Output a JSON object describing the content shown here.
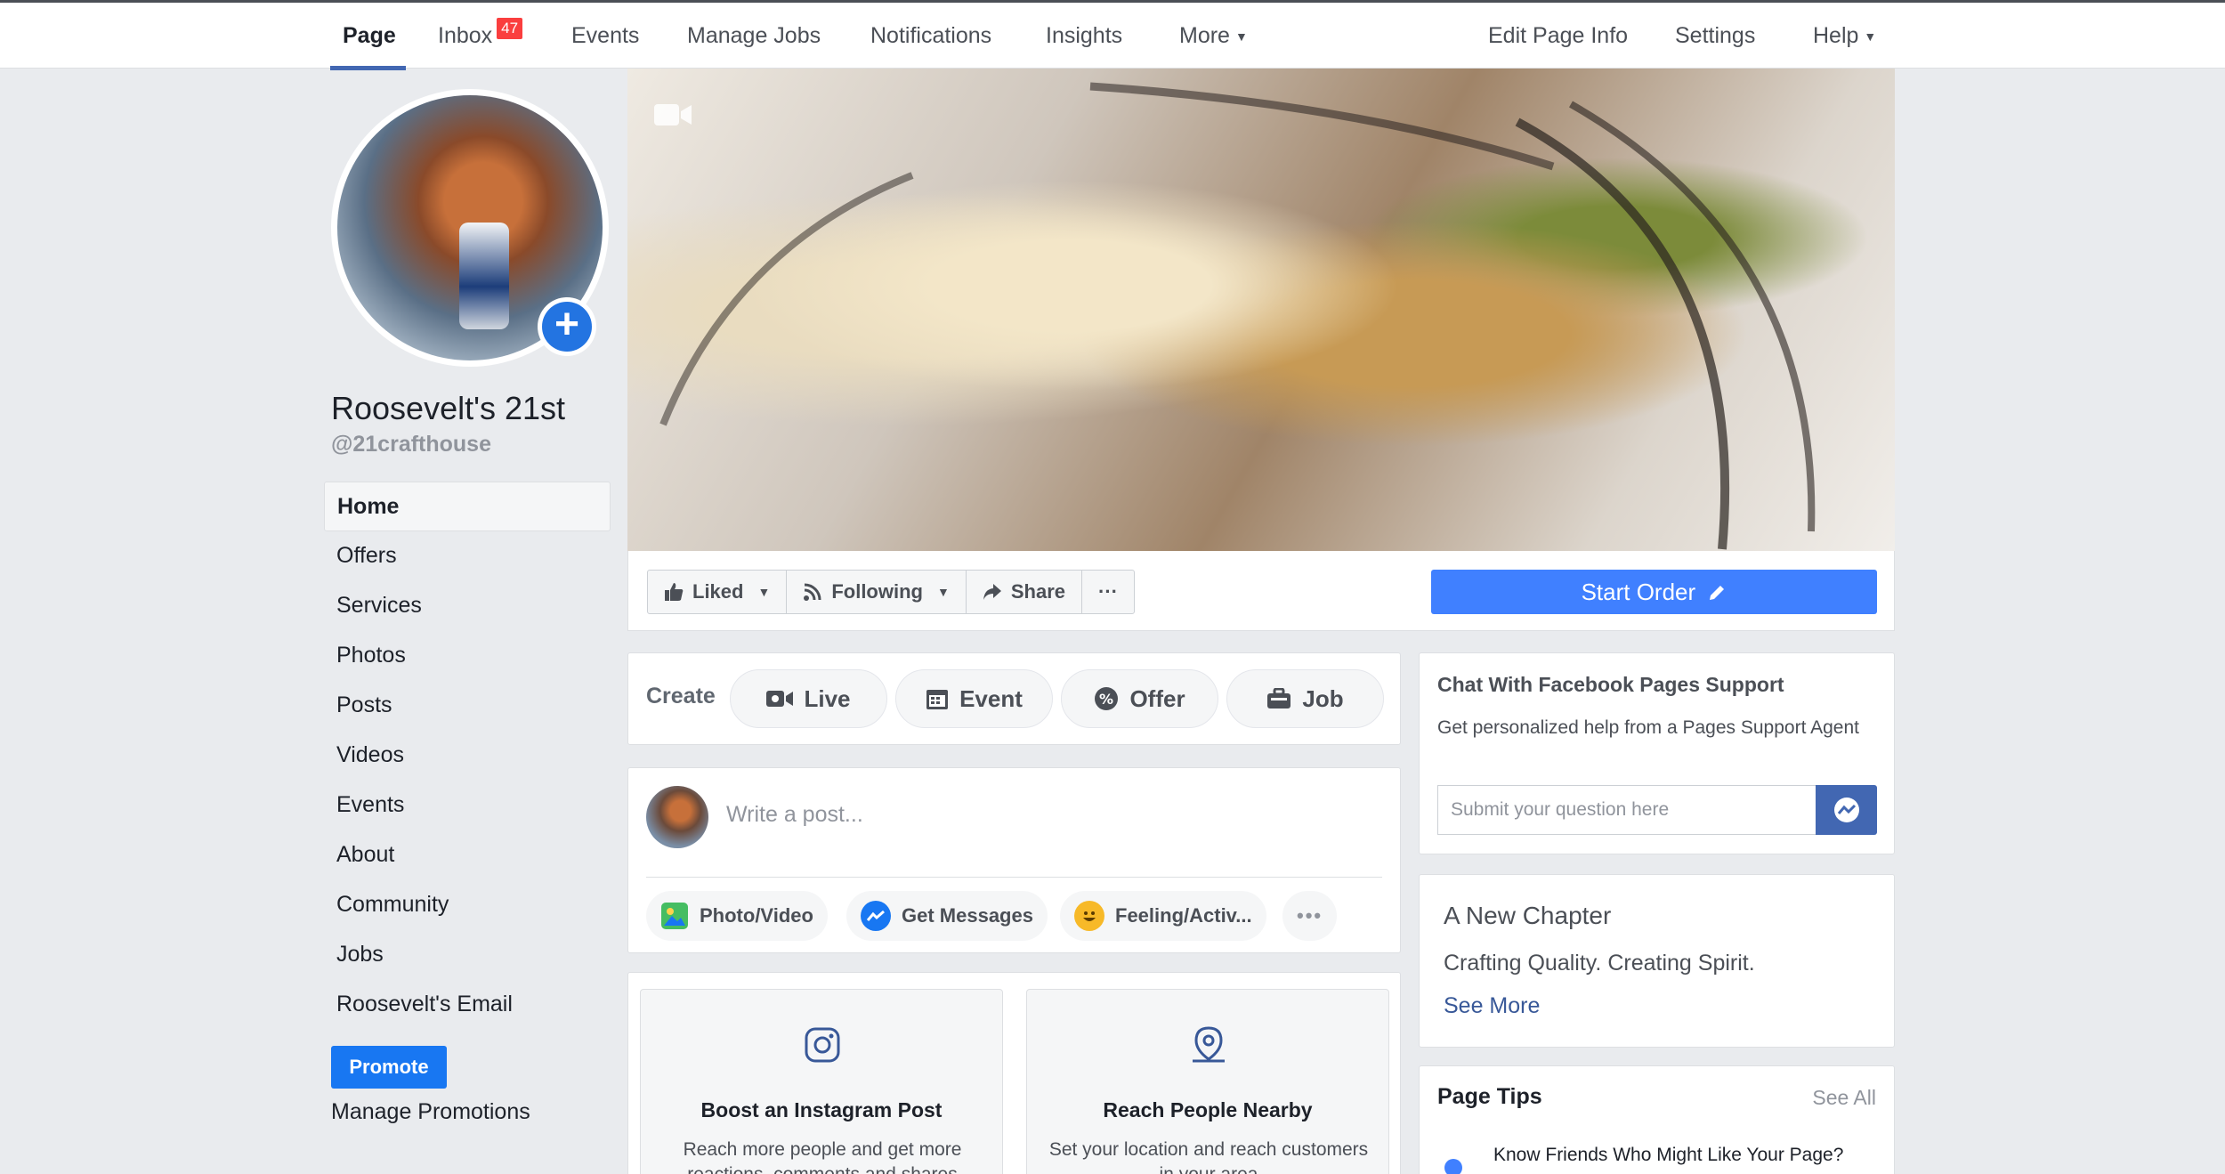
{
  "topnav": {
    "items": [
      {
        "label": "Page"
      },
      {
        "label": "Inbox",
        "badge": "47"
      },
      {
        "label": "Events"
      },
      {
        "label": "Manage Jobs"
      },
      {
        "label": "Notifications"
      },
      {
        "label": "Insights"
      },
      {
        "label": "More"
      }
    ],
    "right_items": [
      {
        "label": "Edit Page Info"
      },
      {
        "label": "Settings"
      },
      {
        "label": "Help"
      }
    ]
  },
  "profile": {
    "name": "Roosevelt's 21st",
    "handle": "@21crafthouse"
  },
  "sidebar": {
    "items": [
      {
        "label": "Home"
      },
      {
        "label": "Offers"
      },
      {
        "label": "Services"
      },
      {
        "label": "Photos"
      },
      {
        "label": "Posts"
      },
      {
        "label": "Videos"
      },
      {
        "label": "Events"
      },
      {
        "label": "About"
      },
      {
        "label": "Community"
      },
      {
        "label": "Jobs"
      },
      {
        "label": "Roosevelt's Email"
      }
    ],
    "promote_label": "Promote",
    "manage_promotions_label": "Manage Promotions"
  },
  "actions": {
    "liked": "Liked",
    "following": "Following",
    "share": "Share",
    "more": "···",
    "start_order": "Start Order"
  },
  "create": {
    "label": "Create",
    "buttons": [
      {
        "label": "Live"
      },
      {
        "label": "Event"
      },
      {
        "label": "Offer"
      },
      {
        "label": "Job"
      }
    ]
  },
  "composer": {
    "placeholder": "Write a post...",
    "buttons": [
      {
        "label": "Photo/Video"
      },
      {
        "label": "Get Messages"
      },
      {
        "label": "Feeling/Activ..."
      }
    ],
    "more": "•••"
  },
  "promos": [
    {
      "title": "Boost an Instagram Post",
      "desc": "Reach more people and get more reactions, comments and shares"
    },
    {
      "title": "Reach People Nearby",
      "desc": "Set your location and reach customers in your area"
    }
  ],
  "chat": {
    "title": "Chat With Facebook Pages Support",
    "desc": "Get personalized help from a Pages Support Agent",
    "placeholder": "Submit your question here"
  },
  "chapter": {
    "title": "A New Chapter",
    "subtitle": "Crafting Quality. Creating Spirit.",
    "see_more": "See More"
  },
  "tips": {
    "title": "Page Tips",
    "see_all": "See All",
    "first_tip": "Know Friends Who Might Like Your Page?"
  },
  "colors": {
    "brand_blue": "#4267b2",
    "cta_blue": "#4080ff",
    "badge_red": "#fa3e3e"
  }
}
